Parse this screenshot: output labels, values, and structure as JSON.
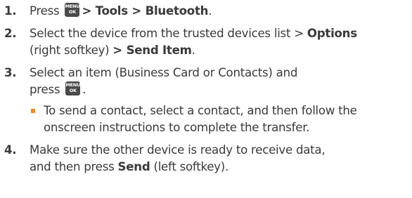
{
  "menu_key": {
    "top": "MENU",
    "bottom": "OK"
  },
  "steps": [
    {
      "num": "1.",
      "t1": "Press",
      "t2": "> Tools > Bluetooth",
      "t3": "."
    },
    {
      "num": "2.",
      "t1": "Select the device from the trusted devices list > ",
      "t2": "Options",
      "t3": "(right softkey) ",
      "t4": "> Send Item",
      "t5": "."
    },
    {
      "num": "3.",
      "t1": "Select an item (Business Card or Contacts) and",
      "t2": "press",
      "t3": ".",
      "sub": "To send a contact, select a contact, and then follow the onscreen instructions to complete the transfer."
    },
    {
      "num": "4.",
      "t1": "Make sure the other device is ready to receive data,",
      "t2": "and then press ",
      "t3": "Send",
      "t4": " (left softkey)."
    }
  ],
  "colors": {
    "text": "#3a3a3a",
    "key_bg": "#4a4a4a",
    "bullet": "#f08a24"
  }
}
